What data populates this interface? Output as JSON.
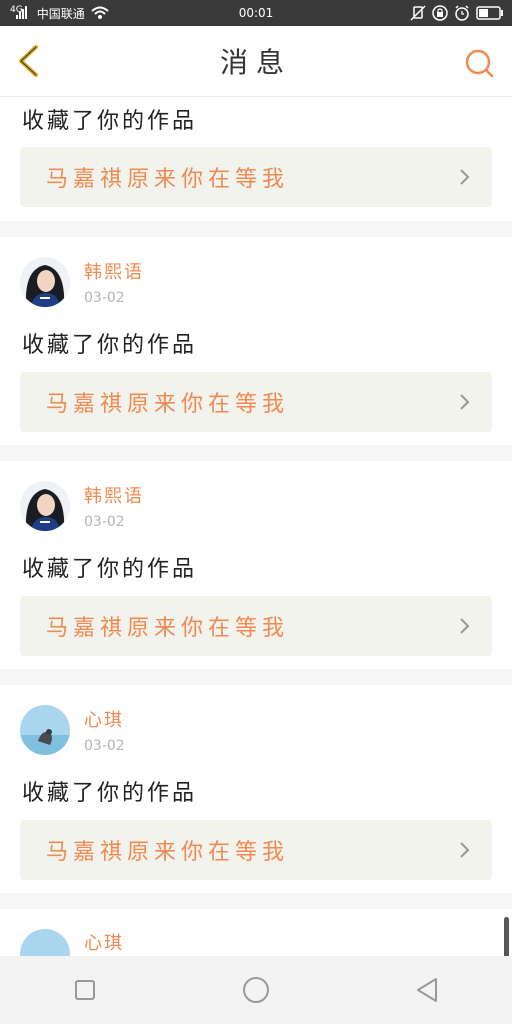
{
  "status_bar": {
    "signal_label": "4G",
    "carrier": "中国联通",
    "time": "00:01",
    "icons": [
      "signal-icon",
      "wifi-icon",
      "mute-icon",
      "lock-rotation-icon",
      "alarm-icon",
      "battery-icon"
    ]
  },
  "header": {
    "title": "消息",
    "back_icon": "chevron-left-icon",
    "search_icon": "search-icon"
  },
  "notifications": [
    {
      "user": "",
      "time": "",
      "action": "收藏了你的作品",
      "work_title": "马嘉祺原来你在等我",
      "avatar": ""
    },
    {
      "user": "韩熙语",
      "time": "03-02",
      "action": "收藏了你的作品",
      "work_title": "马嘉祺原来你在等我",
      "avatar": "dark-portrait"
    },
    {
      "user": "韩熙语",
      "time": "03-02",
      "action": "收藏了你的作品",
      "work_title": "马嘉祺原来你在等我",
      "avatar": "dark-portrait"
    },
    {
      "user": "心琪",
      "time": "03-02",
      "action": "收藏了你的作品",
      "work_title": "马嘉祺原来你在等我",
      "avatar": "sky-bird"
    },
    {
      "user": "心琪",
      "time": "",
      "action": "",
      "work_title": "",
      "avatar": "sky-bird"
    }
  ],
  "nav_bar": {
    "icons": [
      "recent-apps-icon",
      "home-icon",
      "back-triangle-icon"
    ]
  },
  "colors": {
    "accent": "#f08a52",
    "header_back": "#d8a824",
    "status_bar_bg": "#3a3a3a",
    "link_bg": "#f3f3ee"
  }
}
